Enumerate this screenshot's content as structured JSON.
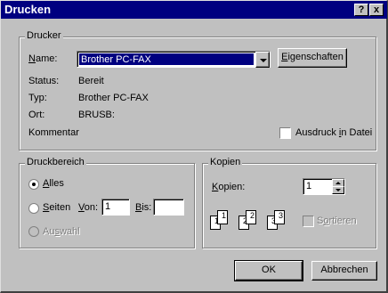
{
  "window": {
    "title": "Drucken",
    "help_button": "?",
    "close_button": "x"
  },
  "printer": {
    "group_label": "Drucker",
    "name_label_u": "N",
    "name_label_rest": "ame:",
    "name_value": "Brother PC-FAX",
    "properties_u": "E",
    "properties_rest": "igenschaften",
    "status_label": "Status:",
    "status_value": "Bereit",
    "type_label": "Typ:",
    "type_value": "Brother PC-FAX",
    "location_label": "Ort:",
    "location_value": "BRUSB:",
    "comment_label": "Kommentar",
    "print_to_file_pre": "Ausdruck ",
    "print_to_file_u": "i",
    "print_to_file_post": "n Datei"
  },
  "range": {
    "group_label": "Druckbereich",
    "all_u": "A",
    "all_rest": "lles",
    "pages_u": "S",
    "pages_rest": "eiten",
    "from_u": "V",
    "from_rest": "on:",
    "from_value": "1",
    "to_u": "B",
    "to_rest": "is:",
    "to_value": "",
    "selection_pre": "Au",
    "selection_u": "s",
    "selection_post": "wahl",
    "selected": "all"
  },
  "copies": {
    "group_label": "Kopien",
    "copies_u": "K",
    "copies_rest": "opien:",
    "copies_value": "1",
    "collate_pre": "S",
    "collate_u": "o",
    "collate_post": "rtieren",
    "collate_checked": false,
    "page_numbers": [
      "1",
      "1",
      "2",
      "2",
      "3",
      "3"
    ]
  },
  "buttons": {
    "ok": "OK",
    "cancel": "Abbrechen"
  }
}
